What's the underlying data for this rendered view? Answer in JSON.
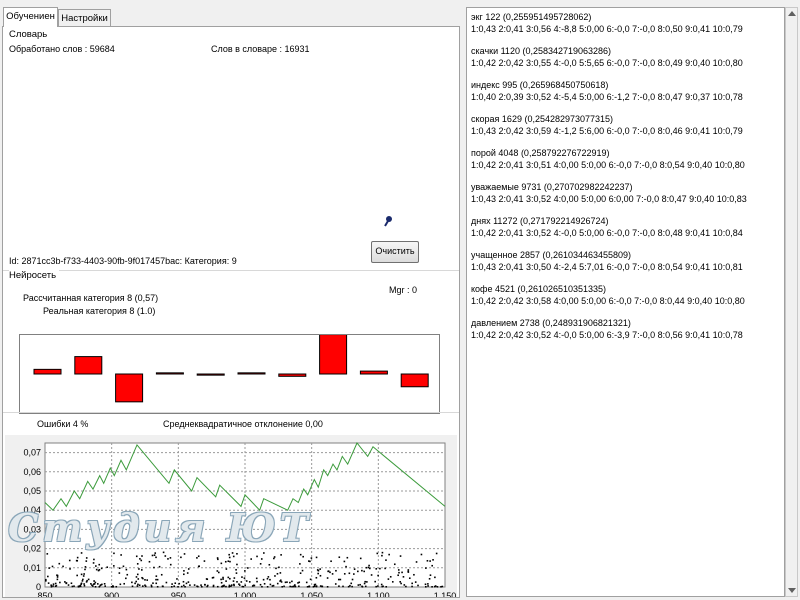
{
  "tabs": [
    {
      "label": "Обучениен"
    },
    {
      "label": "Настройки"
    }
  ],
  "dictionary": {
    "group_label": "Словарь",
    "processed": "Обработано слов : 59684",
    "in_dictionary": "Слов в словаре : 16931",
    "id_line": "Id: 2871cc3b-f733-4403-90fb-9f017457bac: Категория: 9",
    "clear_button": "Очистить"
  },
  "network": {
    "group_label": "Нейросеть",
    "mgr": "Mgr : 0",
    "calc_category": "Рассчитанная категория 8 (0,57)",
    "real_category": "Реальная категория 8 (1.0)",
    "bar_color": "#ff0000",
    "bars": [
      {
        "value": 0.08
      },
      {
        "value": 0.3
      },
      {
        "value": -0.48
      },
      {
        "value": 0.02
      },
      {
        "value": -0.02
      },
      {
        "value": 0.02
      },
      {
        "value": -0.04
      },
      {
        "value": 0.68
      },
      {
        "value": 0.05
      },
      {
        "value": -0.22
      }
    ]
  },
  "stats": {
    "errors": "Ошибки 4 %",
    "stddev": "Среднеквадратичное отклонение 0,00"
  },
  "watermark": "Студия ЮТ",
  "chart_data": {
    "type": "line",
    "xlim": [
      850,
      1150
    ],
    "ylim": [
      0,
      0.075
    ],
    "x_ticks": [
      "850",
      "900",
      "950",
      "1 000",
      "1 050",
      "1 100",
      "1 150"
    ],
    "y_ticks": [
      "0,07",
      "0,06",
      "0,05",
      "0,04",
      "0,03",
      "0,02",
      "0,01",
      "0"
    ],
    "grid": true,
    "line_color": "#3c9b3c",
    "points_color": "#000000",
    "series": [
      {
        "points": [
          [
            850,
            0.044
          ],
          [
            856,
            0.04
          ],
          [
            862,
            0.046
          ],
          [
            866,
            0.042
          ],
          [
            872,
            0.05
          ],
          [
            876,
            0.046
          ],
          [
            882,
            0.055
          ],
          [
            886,
            0.051
          ],
          [
            891,
            0.058
          ],
          [
            894,
            0.054
          ],
          [
            899,
            0.062
          ],
          [
            902,
            0.058
          ],
          [
            907,
            0.066
          ],
          [
            911,
            0.061
          ],
          [
            919,
            0.074
          ],
          [
            943,
            0.054
          ],
          [
            947,
            0.061
          ],
          [
            960,
            0.05
          ],
          [
            964,
            0.057
          ],
          [
            978,
            0.047
          ],
          [
            981,
            0.053
          ],
          [
            997,
            0.042
          ],
          [
            1000,
            0.048
          ],
          [
            1011,
            0.04
          ],
          [
            1014,
            0.046
          ],
          [
            1032,
            0.04
          ],
          [
            1036,
            0.046
          ],
          [
            1040,
            0.044
          ],
          [
            1044,
            0.051
          ],
          [
            1047,
            0.048
          ],
          [
            1052,
            0.056
          ],
          [
            1055,
            0.052
          ],
          [
            1059,
            0.061
          ],
          [
            1062,
            0.058
          ],
          [
            1066,
            0.064
          ],
          [
            1069,
            0.061
          ],
          [
            1073,
            0.068
          ],
          [
            1077,
            0.064
          ],
          [
            1084,
            0.075
          ],
          [
            1092,
            0.068
          ],
          [
            1096,
            0.073
          ],
          [
            1150,
            0.042
          ]
        ]
      }
    ]
  },
  "words": [
    {
      "head": "экг 122 (0,255951495728062)",
      "vals": "1:0,43 2:0,41 3:0,56 4:-8,8 5:0,00 6:-0,0 7:-0,0 8:0,50 9:0,41 10:0,79"
    },
    {
      "head": "скачки 1120 (0,258342719063286)",
      "vals": "1:0,42 2:0,42 3:0,55 4:-0,0 5:5,65 6:-0,0 7:-0,0 8:0,49 9:0,40 10:0,80"
    },
    {
      "head": "индекс 995 (0,265968450750618)",
      "vals": "1:0,40 2:0,39 3:0,52 4:-5,4 5:0,00 6:-1,2 7:-0,0 8:0,47 9:0,37 10:0,78"
    },
    {
      "head": "скорая 1629 (0,254282973077315)",
      "vals": "1:0,43 2:0,42 3:0,59 4:-1,2 5:6,00 6:-0,0 7:-0,0 8:0,46 9:0,41 10:0,79"
    },
    {
      "head": "порой 4048 (0,258792276722919)",
      "vals": "1:0,42 2:0,41 3:0,51 4:0,00 5:0,00 6:-0,0 7:-0,0 8:0,54 9:0,40 10:0,80"
    },
    {
      "head": "уважаемые 9731 (0,270702982242237)",
      "vals": "1:0,43 2:0,41 3:0,52 4:0,00 5:0,00 6:0,00 7:-0,0 8:0,47 9:0,40 10:0,83"
    },
    {
      "head": "днях 11272 (0,271792214926724)",
      "vals": "1:0,42 2:0,41 3:0,52 4:-0,0 5:0,00 6:-0,0 7:-0,0 8:0,48 9:0,41 10:0,84"
    },
    {
      "head": "учащенное 2857 (0,261034463455809)",
      "vals": "1:0,43 2:0,41 3:0,50 4:-2,4 5:7,01 6:-0,0 7:-0,0 8:0,54 9:0,41 10:0,81"
    },
    {
      "head": "кофе 4521 (0,261026510351335)",
      "vals": "1:0,42 2:0,42 3:0,58 4:0,00 5:0,00 6:-0,0 7:-0,0 8:0,44 9:0,40 10:0,80"
    },
    {
      "head": "давлением 2738 (0,248931906821321)",
      "vals": "1:0,42 2:0,42 3:0,52 4:-0,0 5:0,00 6:-3,9 7:-0,0 8:0,56 9:0,41 10:0,78"
    }
  ]
}
